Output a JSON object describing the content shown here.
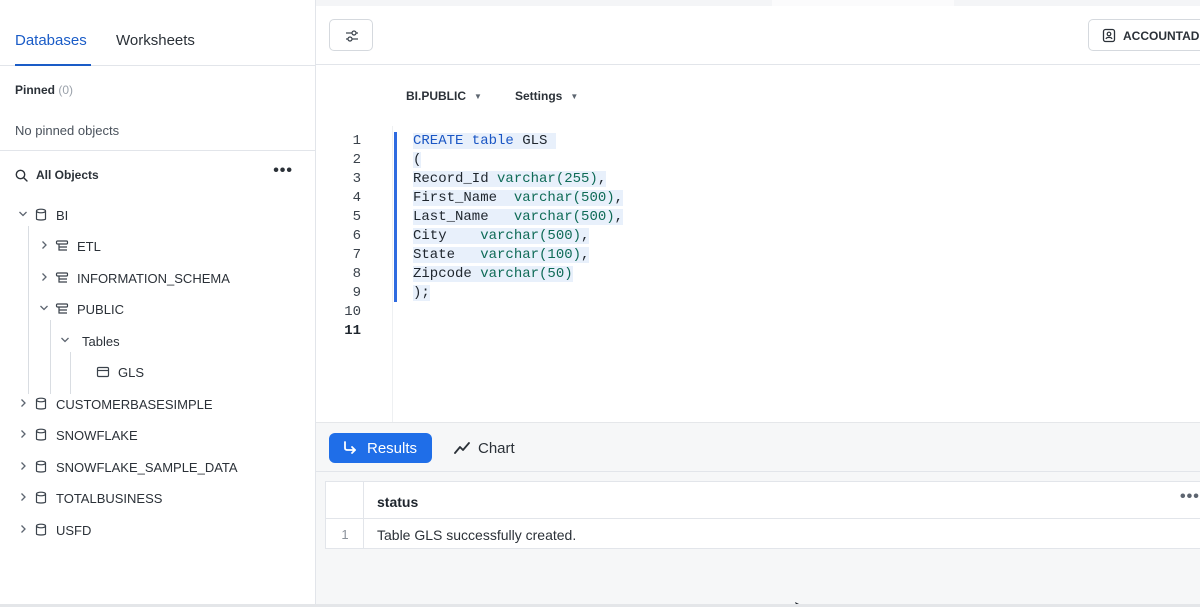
{
  "sidebar": {
    "tabs": [
      {
        "label": "Databases"
      },
      {
        "label": "Worksheets"
      }
    ],
    "pinned": {
      "label": "Pinned",
      "count": "(0)",
      "empty_text": "No pinned objects"
    },
    "all_objects": {
      "label": "All Objects",
      "menu": "•••"
    },
    "tree": {
      "bi": "BI",
      "etl": "ETL",
      "information_schema": "INFORMATION_SCHEMA",
      "public": "PUBLIC",
      "tables": "Tables",
      "gls": "GLS",
      "customerbasesimple": "CUSTOMERBASESIMPLE",
      "snowflake": "SNOWFLAKE",
      "snowflake_sample_data": "SNOWFLAKE_SAMPLE_DATA",
      "totalbusiness": "TOTALBUSINESS",
      "usfd": "USFD"
    }
  },
  "toolbar": {
    "role_label": "ACCOUNTADMIN"
  },
  "context": {
    "schema": "BI.PUBLIC",
    "settings": "Settings"
  },
  "editor": {
    "line_numbers": [
      "1",
      "2",
      "3",
      "4",
      "5",
      "6",
      "7",
      "8",
      "9",
      "10",
      "11"
    ],
    "current_line": "11",
    "code": {
      "l1_kw": "CREATE table",
      "l1_rest": " GLS ",
      "l2": "(",
      "l3_name": "Record_Id ",
      "l3_type": "varchar(255)",
      "l3_end": ",",
      "l4_name": "First_Name  ",
      "l4_type": "varchar(500)",
      "l4_end": ",",
      "l5_name": "Last_Name   ",
      "l5_type": "varchar(500)",
      "l5_end": ",",
      "l6_name": "City    ",
      "l6_type": "varchar(500)",
      "l6_end": ",",
      "l7_name": "State   ",
      "l7_type": "varchar(100)",
      "l7_end": ",",
      "l8_name": "Zipcode ",
      "l8_type": "varchar(50)",
      "l9": ");"
    }
  },
  "results": {
    "results_label": "Results",
    "chart_label": "Chart",
    "column": "status",
    "column_menu": "•••",
    "rows": [
      {
        "index": "1",
        "status": "Table GLS successfully created."
      }
    ]
  },
  "colors": {
    "accent": "#1f6ee8",
    "tab_active": "#1a5cc7",
    "keyword": "#1a56c4",
    "type": "#0f6b57"
  }
}
